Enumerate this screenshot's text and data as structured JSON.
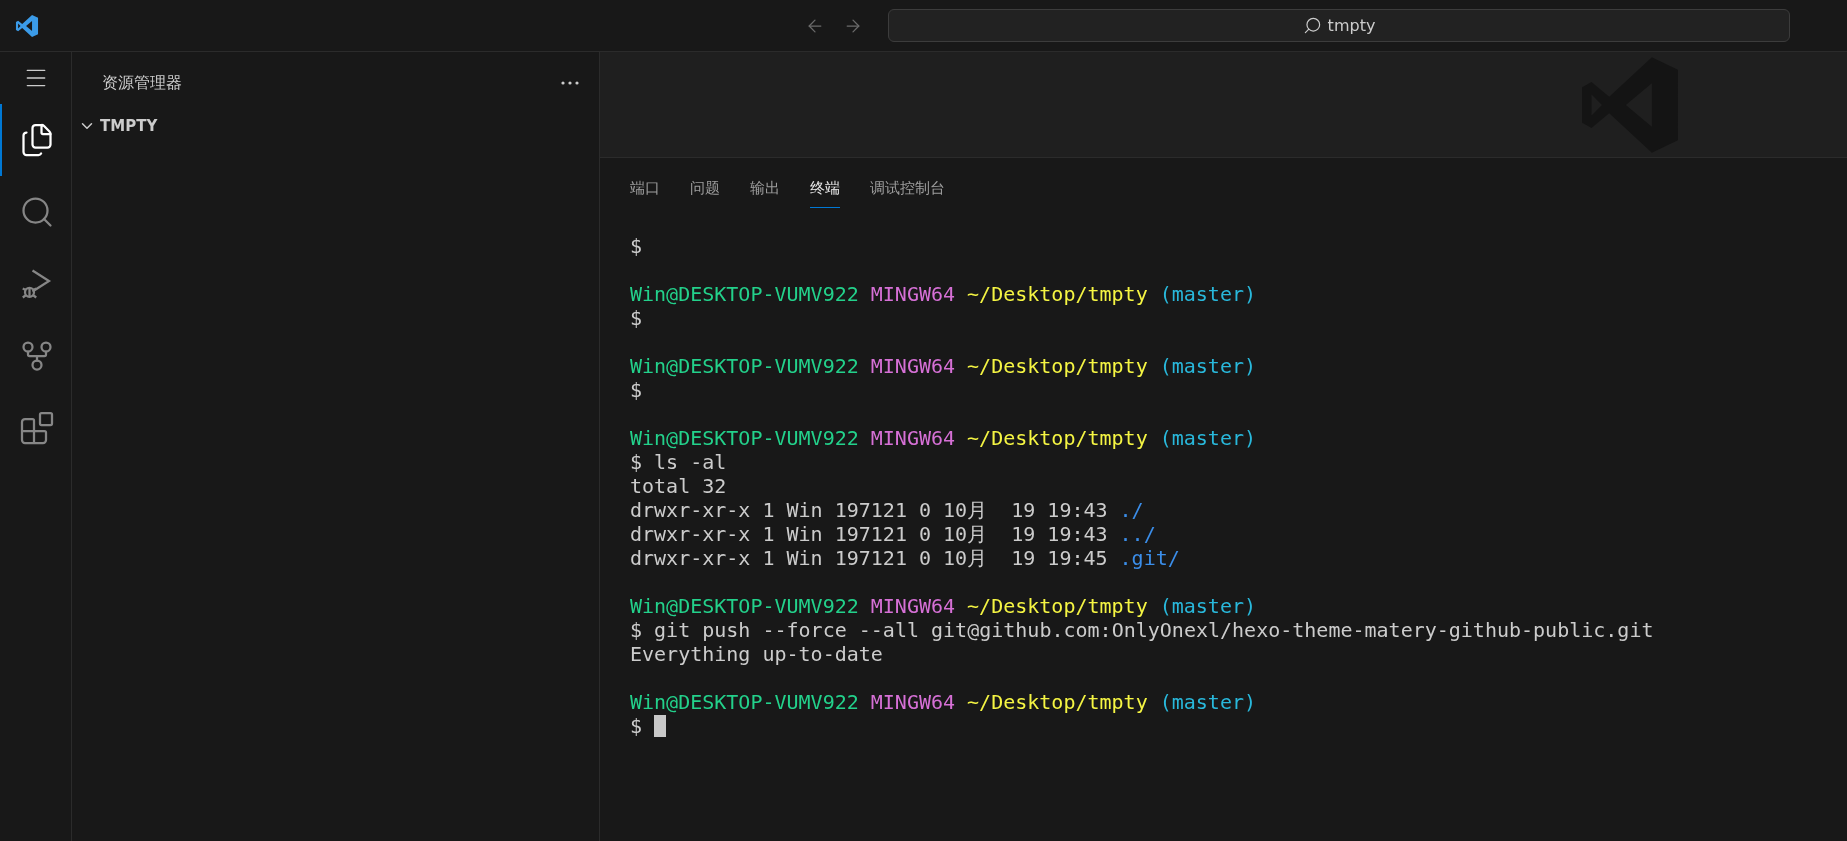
{
  "title_bar": {
    "search": {
      "value": "tmpty"
    }
  },
  "activity_bar": {
    "items": [
      {
        "kind": "explorer",
        "selected": true
      },
      {
        "kind": "search",
        "selected": false
      },
      {
        "kind": "debug",
        "selected": false
      },
      {
        "kind": "source-control",
        "selected": false
      },
      {
        "kind": "extensions",
        "selected": false
      }
    ]
  },
  "sidebar": {
    "title": "资源管理器",
    "tree": [
      {
        "label": "TMPTY",
        "expanded": true
      }
    ]
  },
  "panel": {
    "tabs": [
      {
        "label": "端口",
        "selected": false
      },
      {
        "label": "问题",
        "selected": false
      },
      {
        "label": "输出",
        "selected": false
      },
      {
        "label": "终端",
        "selected": true
      },
      {
        "label": "调试控制台",
        "selected": false
      }
    ],
    "terminal": {
      "blocks": [
        {
          "lines": [
            {
              "segments": [
                {
                  "kind": "plain",
                  "text": "$"
                }
              ]
            }
          ]
        },
        {
          "lines": [
            {
              "segments": [
                {
                  "kind": "user",
                  "text": "Win@DESKTOP-VUMV922"
                },
                {
                  "kind": "system",
                  "text": "MINGW64"
                },
                {
                  "kind": "path",
                  "text": "~/Desktop/tmpty"
                },
                {
                  "kind": "branch",
                  "text": "(master)"
                }
              ]
            },
            {
              "segments": [
                {
                  "kind": "plain",
                  "text": "$"
                }
              ]
            }
          ]
        },
        {
          "lines": [
            {
              "segments": [
                {
                  "kind": "user",
                  "text": "Win@DESKTOP-VUMV922"
                },
                {
                  "kind": "system",
                  "text": "MINGW64"
                },
                {
                  "kind": "path",
                  "text": "~/Desktop/tmpty"
                },
                {
                  "kind": "branch",
                  "text": "(master)"
                }
              ]
            },
            {
              "segments": [
                {
                  "kind": "plain",
                  "text": "$"
                }
              ]
            }
          ]
        },
        {
          "lines": [
            {
              "segments": [
                {
                  "kind": "user",
                  "text": "Win@DESKTOP-VUMV922"
                },
                {
                  "kind": "system",
                  "text": "MINGW64"
                },
                {
                  "kind": "path",
                  "text": "~/Desktop/tmpty"
                },
                {
                  "kind": "branch",
                  "text": "(master)"
                }
              ]
            },
            {
              "segments": [
                {
                  "kind": "plain",
                  "text": "$ ls -al"
                }
              ]
            },
            {
              "segments": [
                {
                  "kind": "plain",
                  "text": "total 32"
                }
              ]
            },
            {
              "segments": [
                {
                  "kind": "plain",
                  "text": "drwxr-xr-x 1 Win 197121 0 10月  19 19:43"
                },
                {
                  "kind": "dir",
                  "text": "./"
                }
              ]
            },
            {
              "segments": [
                {
                  "kind": "plain",
                  "text": "drwxr-xr-x 1 Win 197121 0 10月  19 19:43"
                },
                {
                  "kind": "dir",
                  "text": "../"
                }
              ]
            },
            {
              "segments": [
                {
                  "kind": "plain",
                  "text": "drwxr-xr-x 1 Win 197121 0 10月  19 19:45"
                },
                {
                  "kind": "dir",
                  "text": ".git/"
                }
              ]
            }
          ]
        },
        {
          "lines": [
            {
              "segments": [
                {
                  "kind": "user",
                  "text": "Win@DESKTOP-VUMV922"
                },
                {
                  "kind": "system",
                  "text": "MINGW64"
                },
                {
                  "kind": "path",
                  "text": "~/Desktop/tmpty"
                },
                {
                  "kind": "branch",
                  "text": "(master)"
                }
              ]
            },
            {
              "segments": [
                {
                  "kind": "plain",
                  "text": "$ git push --force --all git@github.com:OnlyOnexl/hexo-theme-matery-github-public.git"
                }
              ]
            },
            {
              "segments": [
                {
                  "kind": "plain",
                  "text": "Everything up-to-date"
                }
              ]
            }
          ]
        },
        {
          "lines": [
            {
              "segments": [
                {
                  "kind": "user",
                  "text": "Win@DESKTOP-VUMV922"
                },
                {
                  "kind": "system",
                  "text": "MINGW64"
                },
                {
                  "kind": "path",
                  "text": "~/Desktop/tmpty"
                },
                {
                  "kind": "branch",
                  "text": "(master)"
                }
              ]
            },
            {
              "segments": [
                {
                  "kind": "plain",
                  "text": "$"
                }
              ],
              "cursor": true
            }
          ]
        }
      ]
    }
  }
}
